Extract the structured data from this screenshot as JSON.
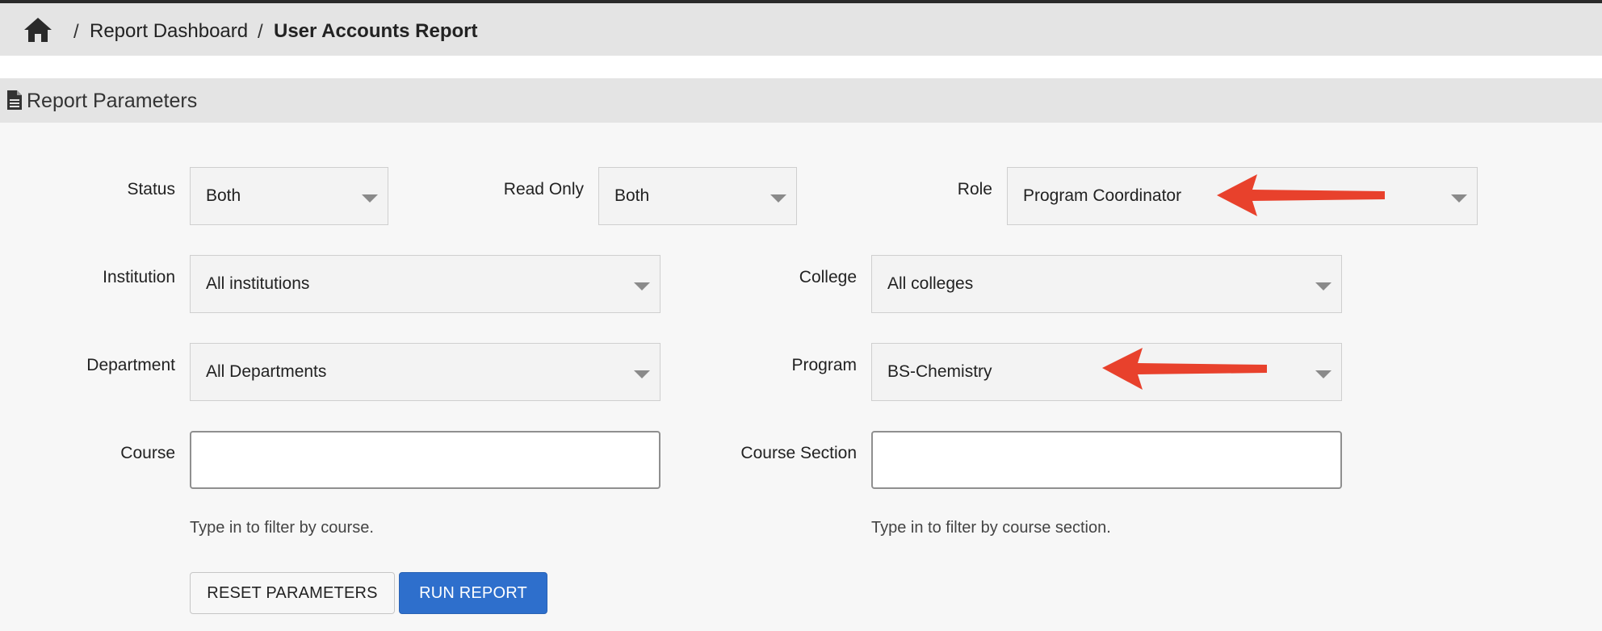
{
  "breadcrumb": {
    "home_icon": "home-icon",
    "separator": "/",
    "items": [
      {
        "label": "Report Dashboard"
      },
      {
        "label": "User Accounts Report"
      }
    ]
  },
  "panel": {
    "icon": "document-icon",
    "title": "Report Parameters"
  },
  "fields": {
    "status": {
      "label": "Status",
      "value": "Both"
    },
    "read_only": {
      "label": "Read Only",
      "value": "Both"
    },
    "role": {
      "label": "Role",
      "value": "Program Coordinator"
    },
    "institution": {
      "label": "Institution",
      "value": "All institutions"
    },
    "college": {
      "label": "College",
      "value": "All colleges"
    },
    "department": {
      "label": "Department",
      "value": "All Departments"
    },
    "program": {
      "label": "Program",
      "value": "BS-Chemistry"
    },
    "course": {
      "label": "Course",
      "value": "",
      "help": "Type in to filter by course."
    },
    "course_section": {
      "label": "Course Section",
      "value": "",
      "help": "Type in to filter by course section."
    }
  },
  "buttons": {
    "reset": "RESET PARAMETERS",
    "run": "RUN REPORT"
  },
  "colors": {
    "accent": "#2e6fcc",
    "annotation_arrow": "#e8412c"
  }
}
